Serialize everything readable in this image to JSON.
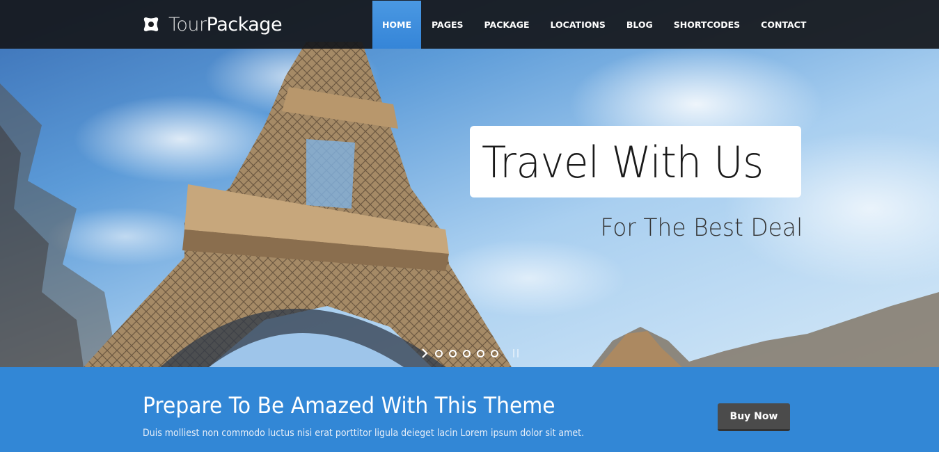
{
  "header": {
    "logo_icon": "flower-logo-icon",
    "logo_light": "Tour",
    "logo_bold": "Package",
    "nav": [
      {
        "label": "HOME",
        "active": true
      },
      {
        "label": "PAGES",
        "active": false
      },
      {
        "label": "PACKAGE",
        "active": false
      },
      {
        "label": "LOCATIONS",
        "active": false
      },
      {
        "label": "BLOG",
        "active": false
      },
      {
        "label": "SHORTCODES",
        "active": false
      },
      {
        "label": "CONTACT",
        "active": false
      }
    ]
  },
  "hero": {
    "image": "eiffel-tower-photo",
    "title": "Travel With Us",
    "subtitle": "For The Best Deal",
    "slider": {
      "next_icon": "chevron-right-icon",
      "dots": 5,
      "pause_icon": "pause-icon"
    }
  },
  "cta": {
    "title": "Prepare To Be Amazed With This Theme",
    "text": "Duis molliest non commodo luctus nisi erat porttitor ligula deieget lacin Lorem ipsum dolor sit amet.",
    "button": "Buy Now"
  },
  "colors": {
    "accent": "#3287d6",
    "nav_bg": "#16181c",
    "button_bg": "#4b4b4b"
  }
}
